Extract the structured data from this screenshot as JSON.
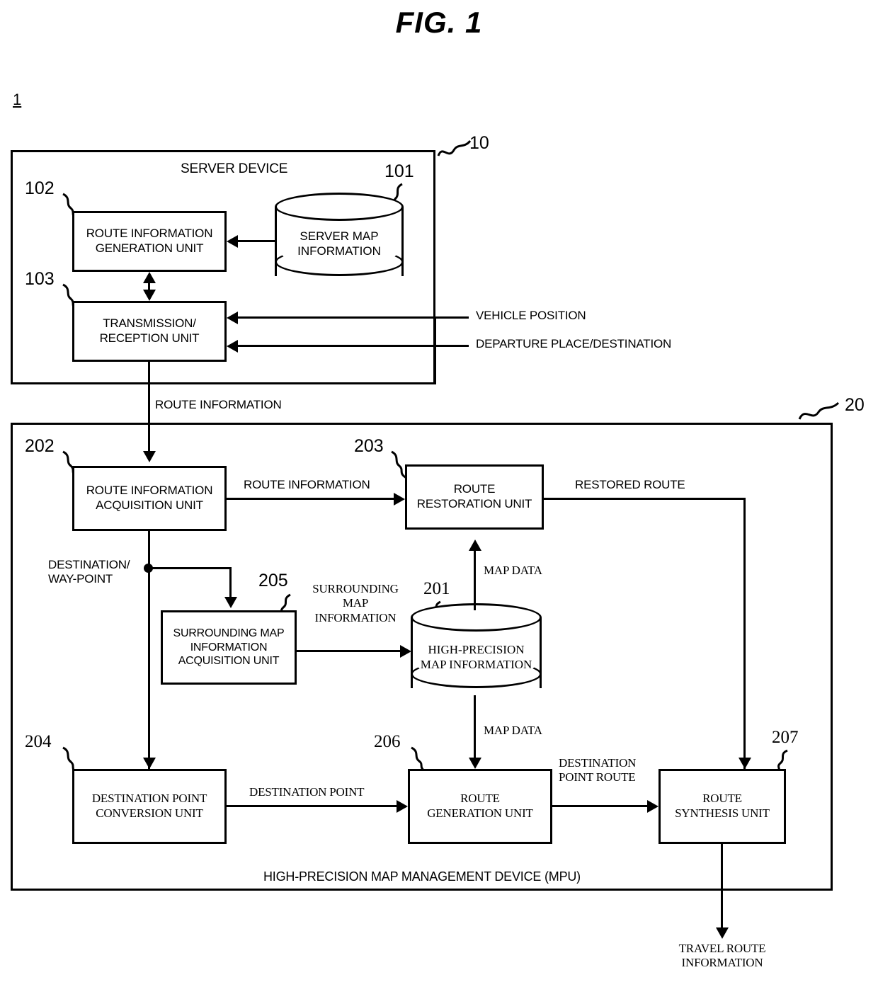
{
  "figure": {
    "title": "FIG. 1",
    "system_ref": "1"
  },
  "server": {
    "ref": "10",
    "title": "SERVER DEVICE",
    "db": {
      "ref": "101",
      "label_line1": "SERVER MAP",
      "label_line2": "INFORMATION"
    },
    "route_info_generation_unit": {
      "ref": "102",
      "line1": "ROUTE INFORMATION",
      "line2": "GENERATION UNIT"
    },
    "transmission_reception_unit": {
      "ref": "103",
      "line1": "TRANSMISSION/",
      "line2": "RECEPTION UNIT"
    },
    "inputs": [
      {
        "label": "VEHICLE POSITION"
      },
      {
        "label": "DEPARTURE PLACE/DESTINATION"
      }
    ]
  },
  "interlink": {
    "route_information": "ROUTE INFORMATION"
  },
  "mpu": {
    "ref": "20",
    "title": "HIGH-PRECISION MAP MANAGEMENT DEVICE (MPU)",
    "route_information_acquisition_unit": {
      "ref": "202",
      "line1": "ROUTE INFORMATION",
      "line2": "ACQUISITION UNIT"
    },
    "route_restoration_unit": {
      "ref": "203",
      "line1": "ROUTE",
      "line2": "RESTORATION UNIT"
    },
    "surrounding_map_information_acquisition_unit": {
      "ref": "205",
      "line1": "SURROUNDING MAP",
      "line2": "INFORMATION",
      "line3": "ACQUISITION UNIT"
    },
    "high_precision_map_db": {
      "ref": "201",
      "line1": "HIGH-PRECISION",
      "line2": "MAP INFORMATION"
    },
    "destination_point_conversion_unit": {
      "ref": "204",
      "line1": "DESTINATION POINT",
      "line2": "CONVERSION UNIT"
    },
    "route_generation_unit": {
      "ref": "206",
      "line1": "ROUTE",
      "line2": "GENERATION UNIT"
    },
    "route_synthesis_unit": {
      "ref": "207",
      "line1": "ROUTE",
      "line2": "SYNTHESIS UNIT"
    },
    "edge_labels": {
      "route_information": "ROUTE INFORMATION",
      "restored_route": "RESTORED ROUTE",
      "destination_waypoint_line1": "DESTINATION/",
      "destination_waypoint_line2": "WAY-POINT",
      "surrounding_map_info_line1": "SURROUNDING",
      "surrounding_map_info_line2": "MAP",
      "surrounding_map_info_line3": "INFORMATION",
      "map_data_top": "MAP DATA",
      "map_data_bottom": "MAP DATA",
      "destination_point": "DESTINATION POINT",
      "destination_point_route_line1": "DESTINATION",
      "destination_point_route_line2": "POINT ROUTE"
    }
  },
  "output": {
    "travel_route_line1": "TRAVEL ROUTE",
    "travel_route_line2": "INFORMATION"
  },
  "colors": {
    "ink": "#000000",
    "paper": "#ffffff"
  }
}
